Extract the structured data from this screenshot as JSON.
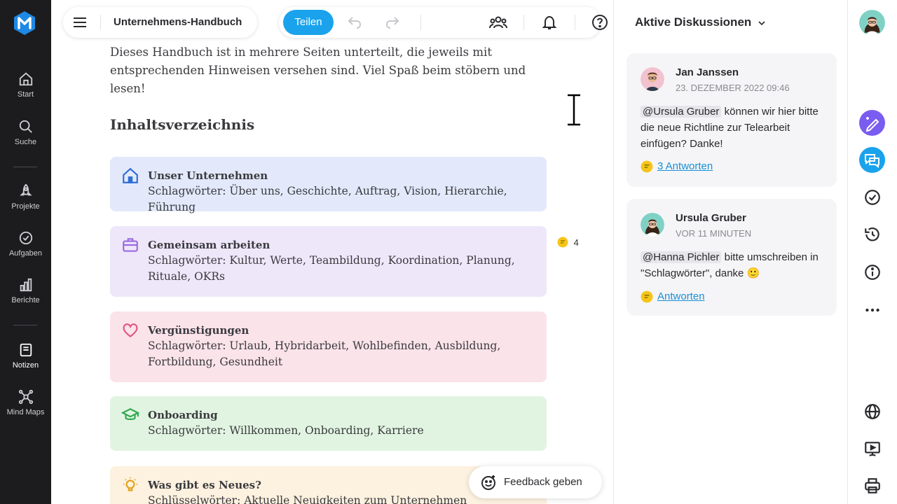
{
  "nav": {
    "items": [
      {
        "label": "Start",
        "icon": "home-icon"
      },
      {
        "label": "Suche",
        "icon": "search-icon"
      },
      {
        "label": "Projekte",
        "icon": "rocket-icon"
      },
      {
        "label": "Aufgaben",
        "icon": "check-circle-icon"
      },
      {
        "label": "Berichte",
        "icon": "bar-chart-icon"
      },
      {
        "label": "Notizen",
        "icon": "note-icon",
        "active": true
      },
      {
        "label": "Mind Maps",
        "icon": "mindmap-icon"
      }
    ]
  },
  "header": {
    "doc_title": "Unternehmens-Handbuch",
    "share_label": "Teilen"
  },
  "document": {
    "intro": "Dieses Handbuch ist in mehrere Seiten unterteilt, die jeweils mit entsprechenden Hinweisen versehen sind. Viel Spaß beim stöbern und lesen!",
    "toc_heading": "Inhaltsverzeichnis",
    "cards": [
      {
        "title": "Unser Unternehmen",
        "tags": "Schlagwörter: Über uns, Geschichte, Auftrag, Vision, Hierarchie, Führung",
        "color": "#e3e9fb",
        "icon": "house-icon"
      },
      {
        "title": "Gemeinsam arbeiten",
        "tags": "Schlagwörter: Kultur, Werte, Teambildung, Koordination, Planung, Rituale, OKRs",
        "color": "#eee7fa",
        "icon": "briefcase-icon"
      },
      {
        "title": "Vergünstigungen",
        "tags": "Schlagwörter: Urlaub, Hybridarbeit, Wohlbefinden, Ausbildung, Fortbildung, Gesundheit",
        "color": "#fbe3ea",
        "icon": "heart-icon"
      },
      {
        "title": "Onboarding",
        "tags": "Schlagwörter: Willkommen, Onboarding, Karriere",
        "color": "#e1f4e1",
        "icon": "graduation-cap-icon"
      },
      {
        "title": "Was gibt es Neues?",
        "tags": "Schlüsselwörter: Aktuelle Neuigkeiten zum Unternehmen",
        "color": "#fdf1df",
        "icon": "lightbulb-icon"
      }
    ],
    "comment_count": "4",
    "feedback_label": "Feedback geben"
  },
  "discussions": {
    "title": "Aktive Diskussionen",
    "items": [
      {
        "author": "Jan Janssen",
        "time": "23. DEZEMBER 2022 09:46",
        "mention": "@Ursula Gruber",
        "text": " können wir hier bitte die neue Richtline zur Telearbeit einfügen? Danke!",
        "reply": "3 Antworten"
      },
      {
        "author": "Ursula Gruber",
        "time": "VOR 11 MINUTEN",
        "mention": "@Hanna Pichler",
        "text": " bitte umschreiben in \"Schlagwörter\", danke 🙂",
        "reply": "Antworten"
      }
    ]
  },
  "colors": {
    "accent": "#1aa3ec",
    "brand": "#1e88e5",
    "ai_purple": "#7b5cf0"
  }
}
